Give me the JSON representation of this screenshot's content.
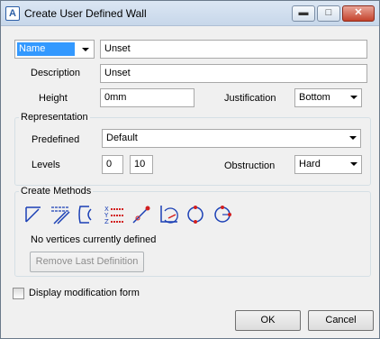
{
  "window": {
    "title": "Create User Defined Wall"
  },
  "name_row": {
    "type_selected": "Name",
    "value": "Unset"
  },
  "description": {
    "label": "Description",
    "value": "Unset"
  },
  "height": {
    "label": "Height",
    "value": "0mm"
  },
  "justification": {
    "label": "Justification",
    "value": "Bottom"
  },
  "representation": {
    "title": "Representation",
    "predefined_label": "Predefined",
    "predefined_value": "Default",
    "levels_label": "Levels",
    "level_from": "0",
    "level_to": "10",
    "obstruction_label": "Obstruction",
    "obstruction_value": "Hard"
  },
  "create_methods": {
    "title": "Create Methods",
    "tools": [
      {
        "icon": "line-wall-icon"
      },
      {
        "icon": "parallel-wall-icon"
      },
      {
        "icon": "curved-wall-icon"
      },
      {
        "icon": "xyz-coordinates-icon"
      },
      {
        "icon": "diagonal-point-icon"
      },
      {
        "icon": "angle-arc-icon"
      },
      {
        "icon": "circle-icon"
      },
      {
        "icon": "circle-point-icon"
      }
    ],
    "status_text": "No vertices currently defined",
    "remove_button_label": "Remove Last Definition"
  },
  "display_form": {
    "label": "Display modification form",
    "checked": false
  },
  "footer": {
    "ok_label": "OK",
    "cancel_label": "Cancel"
  },
  "colors": {
    "accent": "#3399ff",
    "icon_blue": "#1a3fb5",
    "icon_red": "#d21f1f"
  }
}
